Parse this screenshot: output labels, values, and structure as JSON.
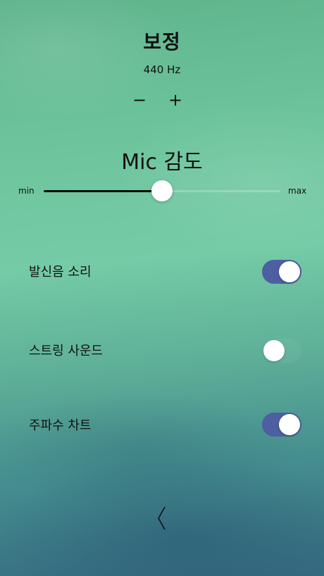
{
  "calibration": {
    "title": "보정",
    "frequency": "440 Hz",
    "decrement_label": "−",
    "increment_label": "+"
  },
  "mic": {
    "title": "Mic 감도",
    "min_label": "min",
    "max_label": "max",
    "sensitivity_fraction": 0.5
  },
  "settings": [
    {
      "label": "발신음 소리",
      "on": true
    },
    {
      "label": "스트링 사운드",
      "on": false
    },
    {
      "label": "주파수 차트",
      "on": true
    }
  ],
  "colors": {
    "toggle_on": "#4d5fa0",
    "slider_fill": "#0c0c0c"
  },
  "icons": {
    "back": "chevron-left-icon"
  }
}
